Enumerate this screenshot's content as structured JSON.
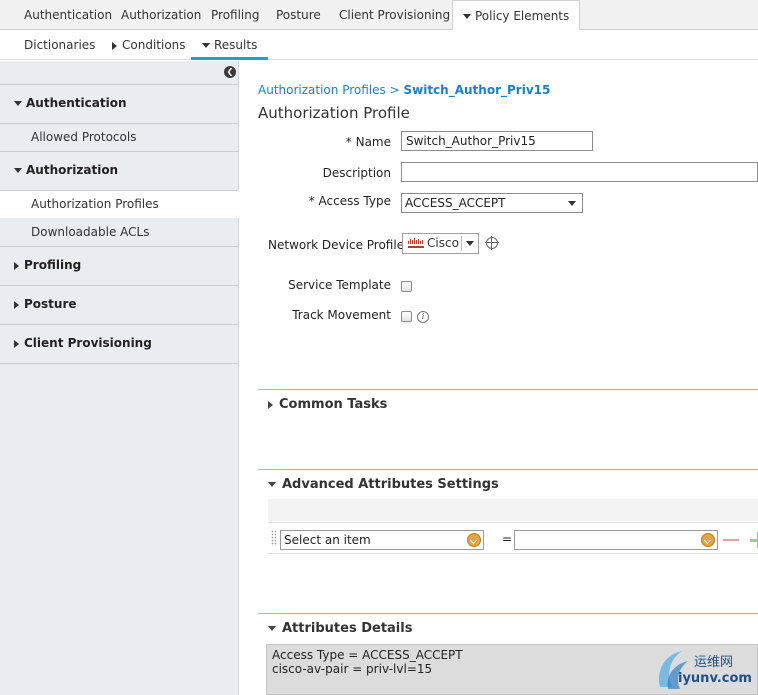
{
  "top_tabs": [
    {
      "label": "Authentication"
    },
    {
      "label": "Authorization"
    },
    {
      "label": "Profiling"
    },
    {
      "label": "Posture"
    },
    {
      "label": "Client Provisioning"
    },
    {
      "label": "Policy Elements",
      "active": true
    }
  ],
  "sub_tabs": [
    {
      "label": "Dictionaries"
    },
    {
      "label": "Conditions"
    },
    {
      "label": "Results",
      "active": true
    }
  ],
  "sidebar": {
    "sections": [
      {
        "label": "Authentication",
        "expanded": true,
        "items": [
          {
            "label": "Allowed Protocols"
          }
        ]
      },
      {
        "label": "Authorization",
        "expanded": true,
        "items": [
          {
            "label": "Authorization Profiles",
            "selected": true
          },
          {
            "label": "Downloadable ACLs"
          }
        ]
      },
      {
        "label": "Profiling",
        "expanded": false
      },
      {
        "label": "Posture",
        "expanded": false
      },
      {
        "label": "Client Provisioning",
        "expanded": false
      }
    ]
  },
  "breadcrumb": {
    "parent": "Authorization Profiles",
    "separator": ">",
    "current": "Switch_Author_Priv15"
  },
  "page_title": "Authorization Profile",
  "form": {
    "name_label": "* Name",
    "name_value": "Switch_Author_Priv15",
    "description_label": "Description",
    "description_value": "",
    "access_type_label": "* Access Type",
    "access_type_value": "ACCESS_ACCEPT",
    "ndp_label": "Network Device Profile",
    "ndp_value": "Cisco",
    "service_template_label": "Service Template",
    "service_template_checked": false,
    "track_movement_label": "Track Movement",
    "track_movement_checked": false
  },
  "sections": {
    "common_tasks": "Common Tasks",
    "advanced": "Advanced Attributes Settings",
    "details": "Attributes Details"
  },
  "advanced_row": {
    "dictionary_placeholder": "Select an item",
    "equals": "=",
    "value": ""
  },
  "attribute_details": [
    "Access Type = ACCESS_ACCEPT",
    "cisco-av-pair = priv-lvl=15"
  ],
  "watermark": {
    "cn": "运维网",
    "url": "iyunv.com"
  },
  "colors": {
    "accent": "#1ba0d7",
    "link": "#1b7fc3",
    "sidebar_bg": "#e9ecf1"
  }
}
